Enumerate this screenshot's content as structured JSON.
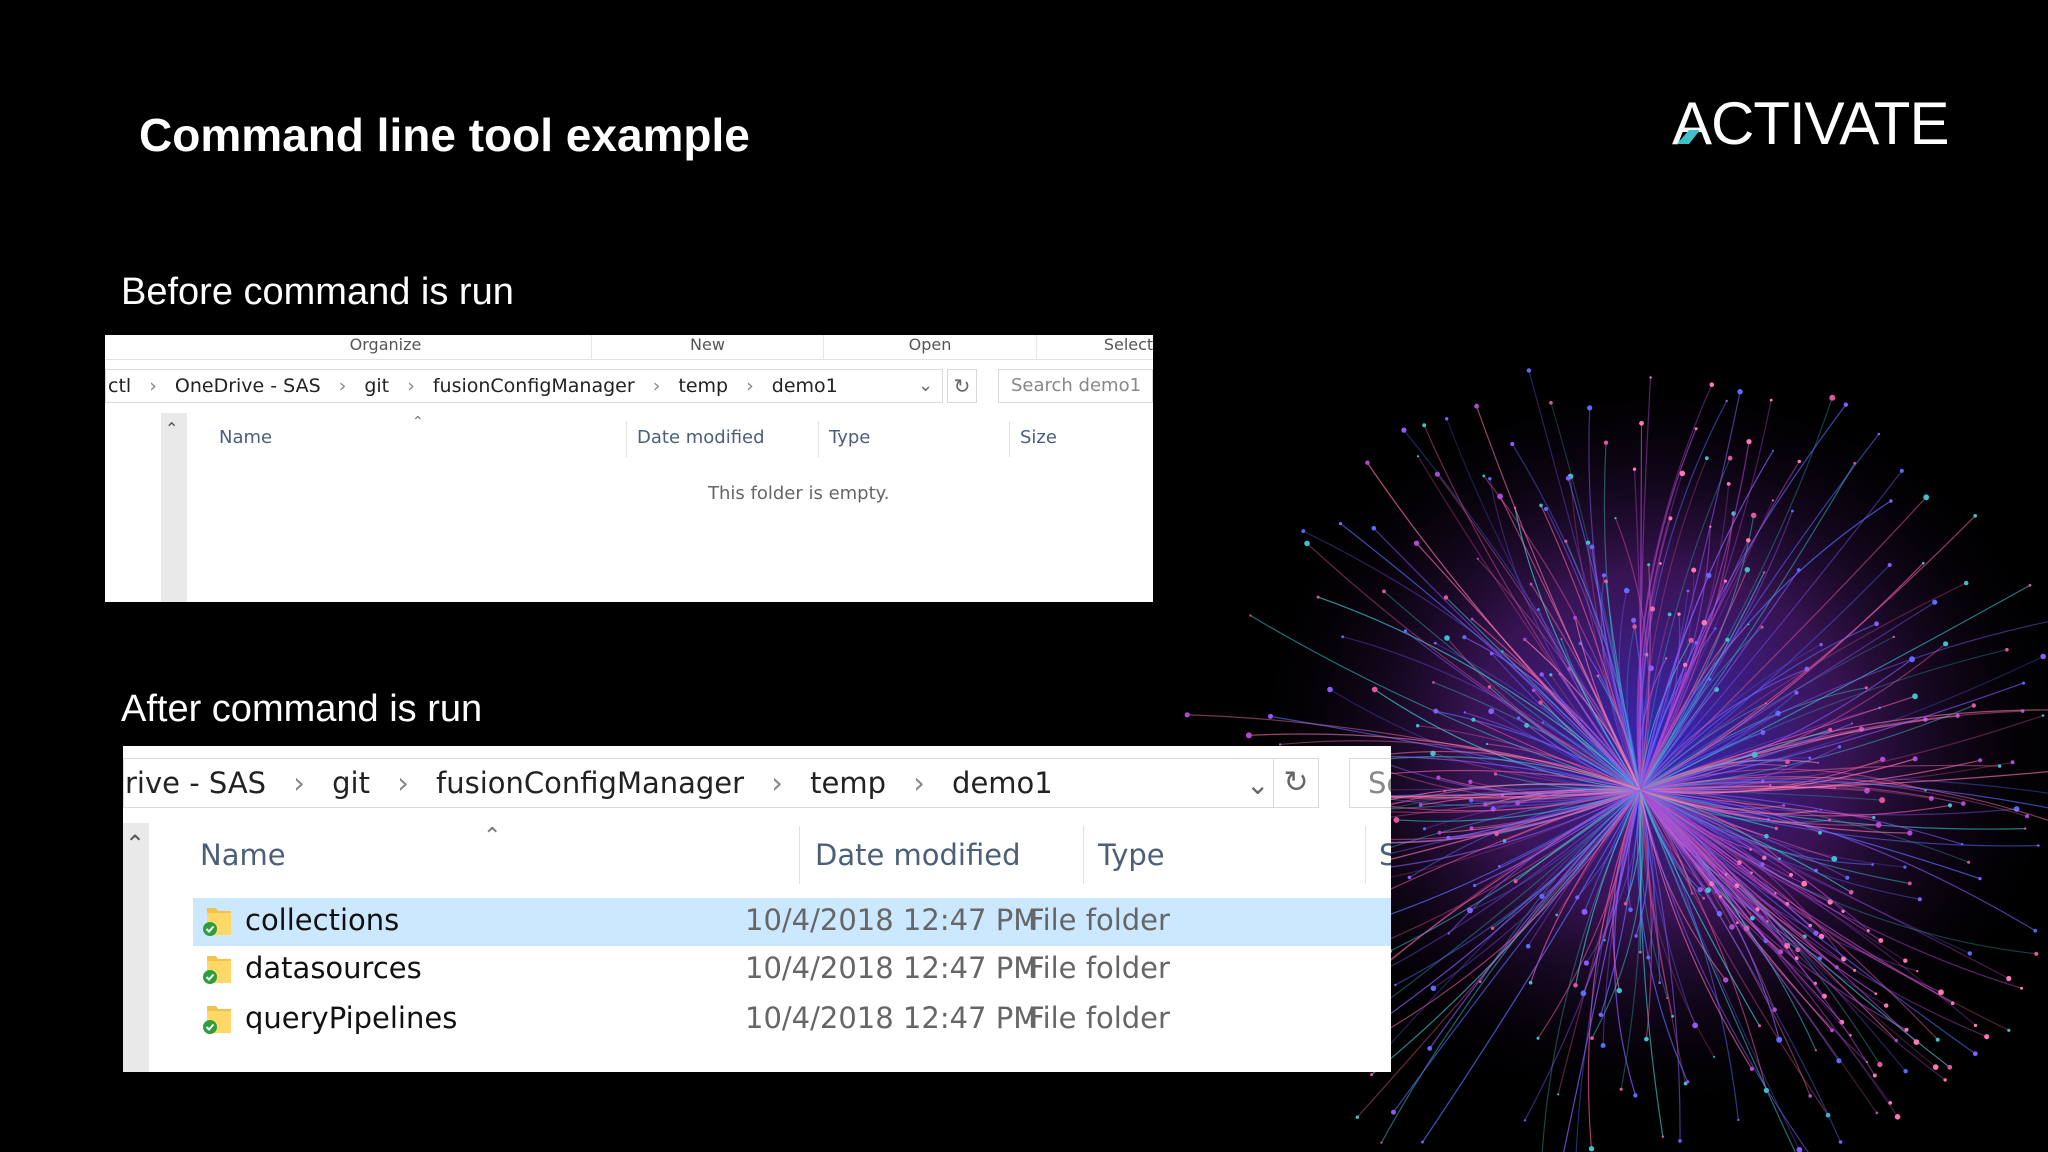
{
  "slide": {
    "title": "Command line tool example",
    "logo_text": "ACTIVATE",
    "before_label": "Before command is run",
    "after_label": "After command is run"
  },
  "colors": {
    "background": "#000000",
    "accent": "#3fc1c9",
    "selected_row": "#cce8ff"
  },
  "before": {
    "ribbon": [
      "Organize",
      "New",
      "Open",
      "Select"
    ],
    "breadcrumbs": [
      "ctl",
      "OneDrive - SAS",
      "git",
      "fusionConfigManager",
      "temp",
      "demo1"
    ],
    "search_placeholder": "Search demo1",
    "columns": [
      "Name",
      "Date modified",
      "Type",
      "Size"
    ],
    "empty_message": "This folder is empty."
  },
  "after": {
    "breadcrumbs": [
      "rive - SAS",
      "git",
      "fusionConfigManager",
      "temp",
      "demo1"
    ],
    "search_placeholder": "Se",
    "columns": [
      "Name",
      "Date modified",
      "Type",
      "S"
    ],
    "rows": [
      {
        "name": "collections",
        "date": "10/4/2018 12:47 PM",
        "type": "File folder",
        "selected": true
      },
      {
        "name": "datasources",
        "date": "10/4/2018 12:47 PM",
        "type": "File folder",
        "selected": false
      },
      {
        "name": "queryPipelines",
        "date": "10/4/2018 12:47 PM",
        "type": "File folder",
        "selected": false
      }
    ]
  },
  "icons": [
    "chevron-right-icon",
    "chevron-down-icon",
    "refresh-icon",
    "scroll-up-icon",
    "sort-caret-icon",
    "folder-sync-icon"
  ]
}
